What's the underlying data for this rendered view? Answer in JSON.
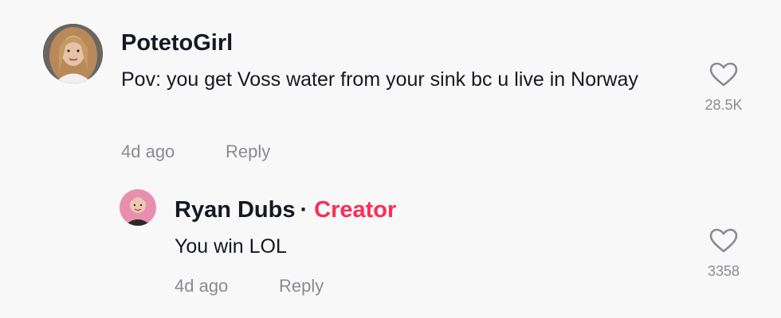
{
  "comments": [
    {
      "username": "PotetoGirl",
      "text": "Pov: you get Voss water from your sink bc u live in Norway",
      "time": "4d ago",
      "reply_label": "Reply",
      "like_count": "28.5K",
      "avatar_icon": "user-avatar-photo",
      "like_icon": "heart-outline-icon"
    }
  ],
  "replies": [
    {
      "username": "Ryan Dubs",
      "separator": "·",
      "badge": "Creator",
      "text": "You win LOL",
      "time": "4d ago",
      "reply_label": "Reply",
      "like_count": "3358",
      "avatar_icon": "user-avatar-photo",
      "like_icon": "heart-outline-icon"
    }
  ],
  "colors": {
    "background": "#f8f8f8",
    "text": "#161823",
    "muted": "#8a8b91",
    "creator_badge": "#fe2c55"
  }
}
